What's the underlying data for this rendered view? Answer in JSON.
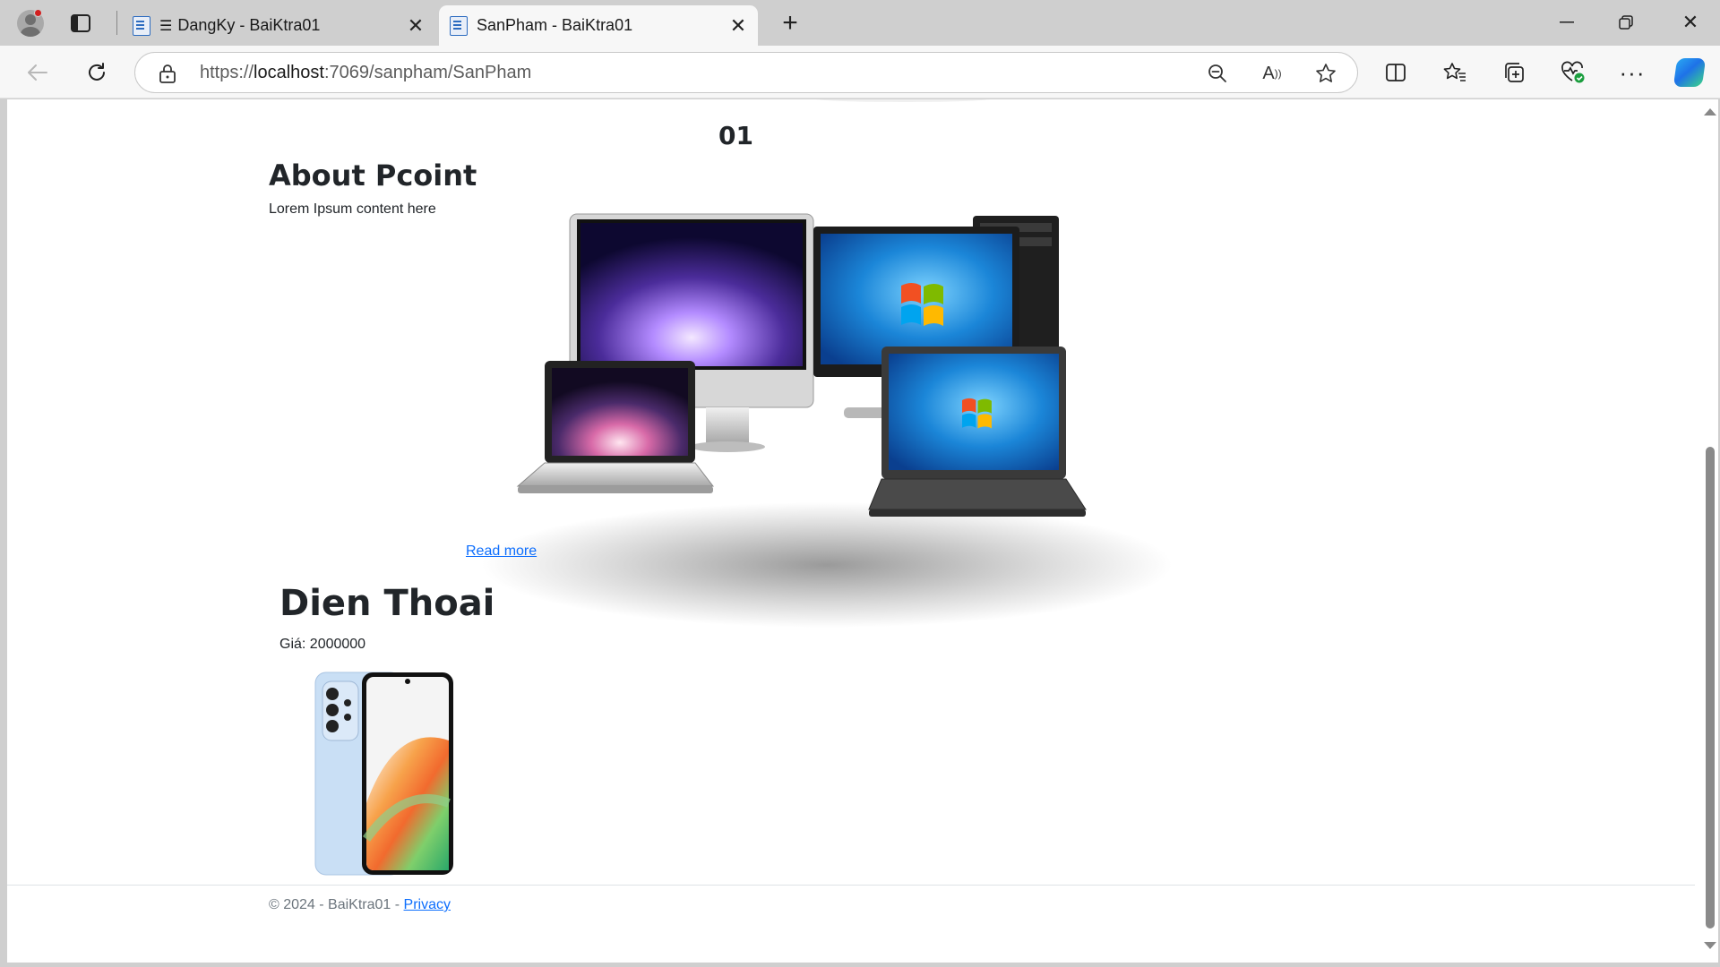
{
  "browser": {
    "tabs": [
      {
        "title": "DangKy - BaiKtra01",
        "active": false,
        "reader_mode": true
      },
      {
        "title": "SanPham - BaiKtra01",
        "active": true,
        "reader_mode": false
      }
    ],
    "url": {
      "scheme": "https://",
      "host": "localhost",
      "rest": ":7069/sanpham/SanPham"
    },
    "icons": {
      "profile": "profile-avatar-icon",
      "tab_actions": "tab-actions-icon",
      "new_tab": "plus-icon",
      "back": "arrow-left-icon",
      "refresh": "refresh-icon",
      "lock": "lock-icon",
      "zoom": "zoom-out-icon",
      "read_aloud": "read-aloud-icon",
      "favorite": "star-icon",
      "split_screen": "split-screen-icon",
      "favorites": "favorites-list-icon",
      "collections": "collections-icon",
      "browser_essentials": "heart-pulse-icon",
      "more": "ellipsis-icon",
      "copilot": "copilot-icon"
    }
  },
  "page": {
    "product_code": "01",
    "about": {
      "heading": "About Pcoint",
      "text": "Lorem Ipsum content here",
      "read_more": "Read more"
    },
    "product": {
      "name": "Dien Thoai",
      "price_label": "Giá: 2000000"
    },
    "footer": {
      "text": "© 2024 - BaiKtra01 - ",
      "privacy": "Privacy"
    }
  }
}
